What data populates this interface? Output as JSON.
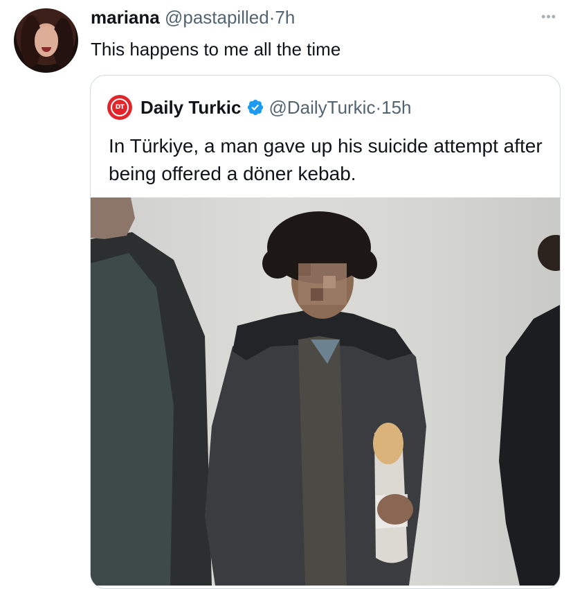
{
  "tweet": {
    "author_name": "mariana",
    "author_handle": "@pastapilled",
    "separator": "·",
    "time": "7h",
    "more_icon": "more-horizontal-icon",
    "text": "This happens to me all the time"
  },
  "quoted_tweet": {
    "logo_text": "DT",
    "logo_color": "#e0262b",
    "author_name": "Daily Turkic",
    "verified_icon": "verified-badge-icon",
    "verified_color": "#1d9bf0",
    "author_handle": "@DailyTurkic",
    "separator": "·",
    "time": "15h",
    "text": "In Türkiye, a man gave up his suicide attempt after being offered a döner kebab.",
    "photo": "photo-man-holding-doner-kebab"
  }
}
